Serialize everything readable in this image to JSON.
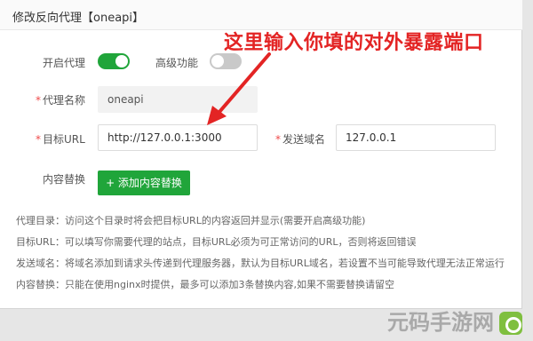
{
  "dialog": {
    "title": "修改反向代理【oneapi】"
  },
  "annotation": "这里输入你填的对外暴露端口",
  "form": {
    "enable_proxy_label": "开启代理",
    "enable_proxy_on": true,
    "advanced_label": "高级功能",
    "advanced_on": false,
    "proxy_name_label": "代理名称",
    "proxy_name_value": "oneapi",
    "target_url_label": "目标URL",
    "target_url_value": "http://127.0.0.1:3000",
    "send_domain_label": "发送域名",
    "send_domain_value": "127.0.0.1",
    "content_replace_label": "内容替换",
    "add_button_label": "+ 添加内容替换"
  },
  "help": [
    "代理目录：访问这个目录时将会把目标URL的内容返回并显示(需要开启高级功能)",
    "目标URL：可以填写你需要代理的站点，目标URL必须为可正常访问的URL，否则将返回错误",
    "发送域名：将域名添加到请求头传递到代理服务器，默认为目标URL域名，若设置不当可能导致代理无法正常运行",
    "内容替换：只能在使用nginx时提供，最多可以添加3条替换内容,如果不需要替换请留空"
  ],
  "watermark": "元码手游网",
  "colors": {
    "accent": "#20a53a",
    "annotation": "#e32424"
  }
}
